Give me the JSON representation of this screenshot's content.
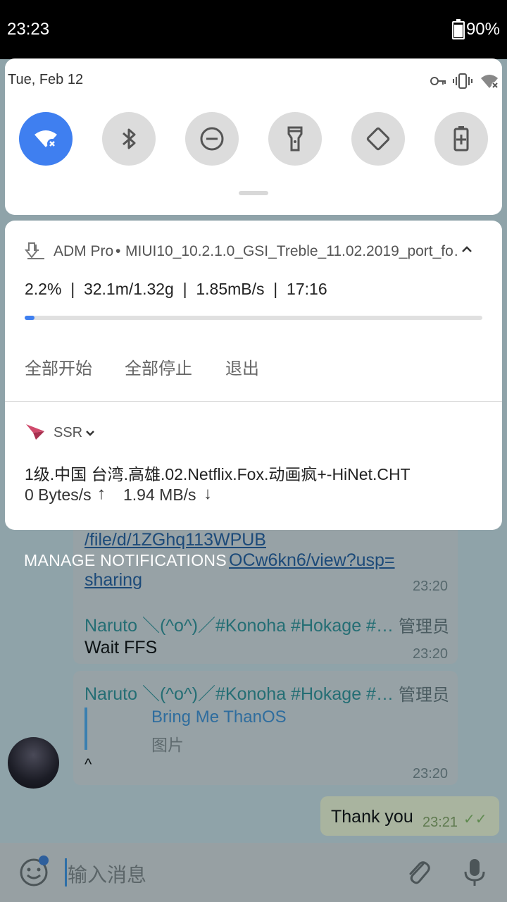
{
  "status_bar": {
    "time": "23:23",
    "battery_percent": "90%"
  },
  "quick_settings": {
    "date": "Tue, Feb 12",
    "tiles": [
      {
        "name": "wifi-off",
        "active": true
      },
      {
        "name": "bluetooth",
        "active": false
      },
      {
        "name": "do-not-disturb",
        "active": false
      },
      {
        "name": "flashlight",
        "active": false
      },
      {
        "name": "auto-rotate",
        "active": false
      },
      {
        "name": "battery-saver",
        "active": false
      }
    ]
  },
  "adm_notification": {
    "app": "ADM Pro",
    "separator": "•",
    "file": "MIUI10_10.2.1.0_GSI_Treble_11.02.2019_port_fo…",
    "stats": "2.2%  |  32.1m/1.32g  |  1.85mB/s  |  17:16",
    "progress": 0.022,
    "actions": [
      "全部开始",
      "全部停止",
      "退出"
    ]
  },
  "ssr_notification": {
    "app": "SSR",
    "server": "1级.中国 台湾.高雄.02.Netflix.Fox.动画疯+-HiNet.CHT",
    "upload": "0 Bytes/s",
    "download": "1.94 MB/s"
  },
  "manage_notifications": "MANAGE NOTIFICATIONS",
  "chat": {
    "msg1": {
      "link_lines": [
        "/file/d/1ZGhq113WPUB",
        "OCw6kn6/view?usp=",
        "sharing"
      ],
      "time": "23:20"
    },
    "msg2": {
      "sender": "Naruto ＼(^o^)／#Konoha #Hokage #…",
      "role": "管理员",
      "text": "Wait FFS",
      "time": "23:20"
    },
    "msg3": {
      "sender": "Naruto ＼(^o^)／#Konoha #Hokage #…",
      "role": "管理员",
      "reply_name": "Bring Me ThanOS",
      "reply_text": "图片",
      "text": "^",
      "time": "23:20"
    },
    "msg4": {
      "text": "Thank you",
      "time": "23:21"
    },
    "input_placeholder": "输入消息"
  }
}
